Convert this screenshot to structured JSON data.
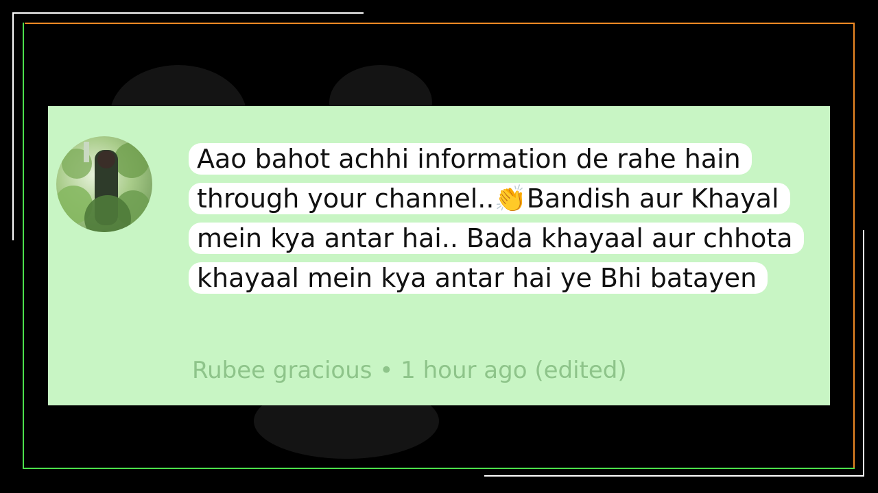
{
  "comment": {
    "author": "Rubee gracious",
    "separator": "•",
    "timestamp": "1 hour ago",
    "edited": "(edited)",
    "text_part1": "Aao bahot achhi information de rahe hain through your channel..",
    "emoji": "👏",
    "emoji_name": "clapping-hands-emoji",
    "text_part2": "Bandish aur Khayal mein kya antar hai.. Bada khayaal aur chhota khayaal mein kya antar hai ye Bhi batayen",
    "avatar_icon": "user-avatar-photo"
  },
  "colors": {
    "frame_green": "#4be04b",
    "frame_orange": "#f08a24",
    "frame_white": "#ffffff",
    "card_bg": "#c8f5c4",
    "highlight": "#ffffff",
    "meta_text": "#8ec48a"
  }
}
